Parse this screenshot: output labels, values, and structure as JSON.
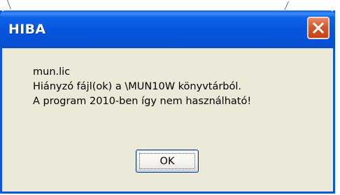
{
  "dialog": {
    "title": "HIBA",
    "message_lines": [
      "mun.lic",
      "Hiányzó fájl(ok) a \\MUN10W könyvtárból.",
      "A program 2010-ben így nem használható!"
    ],
    "ok_label": "OK",
    "close_icon": "close-icon"
  },
  "colors": {
    "titlebar": "#0855dd",
    "close_button": "#d3582f",
    "dialog_body": "#ece9d8"
  }
}
